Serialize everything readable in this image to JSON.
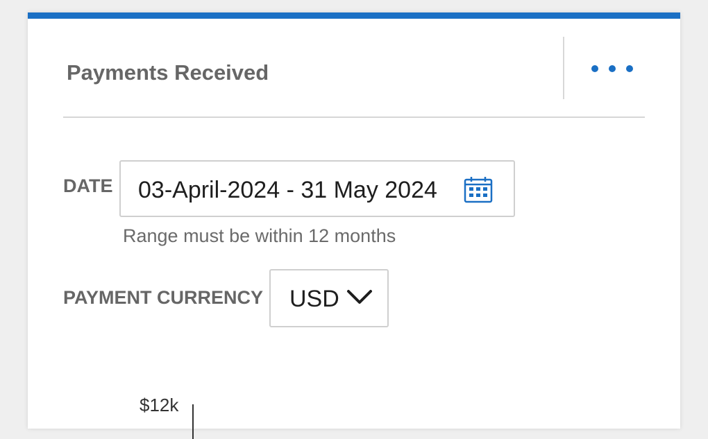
{
  "card": {
    "title": "Payments Received",
    "accent_color": "#1a6fc4",
    "more_menu_icon": "more-horizontal-icon"
  },
  "date_filter": {
    "label": "DATE",
    "value": "03-April-2024 - 31 May 2024",
    "icon": "calendar-icon",
    "hint": "Range must be within 12 months"
  },
  "currency_filter": {
    "label": "PAYMENT CURRENCY",
    "selected": "USD",
    "icon": "chevron-down-icon"
  },
  "chart": {
    "y_tick_top": "$12k"
  }
}
